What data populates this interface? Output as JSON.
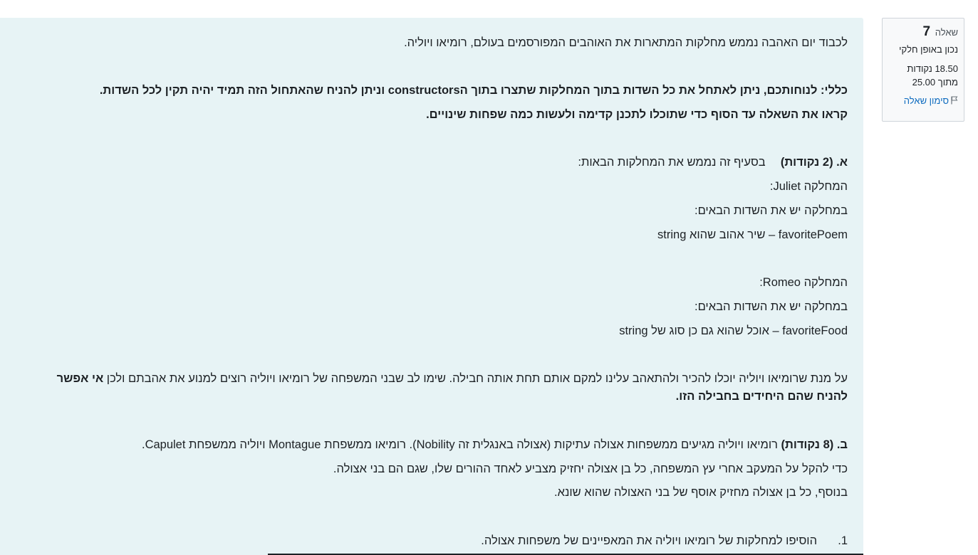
{
  "info": {
    "question_label": "שאלה",
    "question_number": "7",
    "state": "נכון באופן חלקי",
    "grade_line1": "18.50 נקודות",
    "grade_line2": "מתוך 25.00",
    "flag_label": "סימון שאלה",
    "flag_icon": "flag-icon"
  },
  "question": {
    "intro": "לכבוד יום האהבה נממש מחלקות המתארות את האוהבים המפורסמים בעולם, רומיאו ויוליה.",
    "general_note": "כללי:  לנוחותכם, ניתן לאתחל את כל השדות בתוך המחלקות שתצרו בתוך הconstructors וניתן להניח שהאתחול הזה תמיד יהיה תקין לכל השדות.",
    "read_note": "קראו את השאלה עד הסוף כדי שתוכלו לתכנן קדימה ולעשות כמה שפחות שינויים.",
    "part_a_label": "א.  (2 נקודות)",
    "part_a_text": "בסעיף זה נממש את המחלקות הבאות:",
    "juliet_title": "המחלקה Juliet:",
    "juliet_fields_intro": "במחלקה יש את השדות הבאים:",
    "juliet_field": "favoritePoem – שיר אהוב שהוא string",
    "romeo_title": "המחלקה Romeo:",
    "romeo_fields_intro": "במחלקה יש את השדות הבאים:",
    "romeo_field": "favoriteFood – אוכל שהוא גם כן סוג של string",
    "story_line1_normal": "על מנת שרומיאו ויוליה יוכלו להכיר ולהתאהב עלינו למקם אותם תחת אותה חבילה. שימו לב שבני המשפחה של רומיאו ויוליה רוצים למנוע את אהבתם ולכן ",
    "story_line1_bold": "אי אפשר",
    "story_line2_bold": "להניח שהם היחידים בחבילה הזו.",
    "part_b_label": "ב.  (8 נקודות)",
    "part_b_text": "רומיאו ויוליה מגיעים ממשפחות אצולה עתיקות (אצולה באנגלית זה Nobility). רומיאו ממשפחת Montague ויוליה ממשפחת Capulet.",
    "part_b_line2": "כדי להקל על המעקב אחרי עץ המשפחה, כל בן אצולה יחזיק מצביע לאחד ההורים שלו, שגם הם בני אצולה.",
    "part_b_line3": "בנוסף, כל בן אצולה מחזיק אוסף של בני האצולה שהוא שונא.",
    "item1_number": "1.",
    "item1_text": "הוסיפו למחלקות של רומיאו ויוליה את המאפיינים של משפחות אצולה."
  }
}
